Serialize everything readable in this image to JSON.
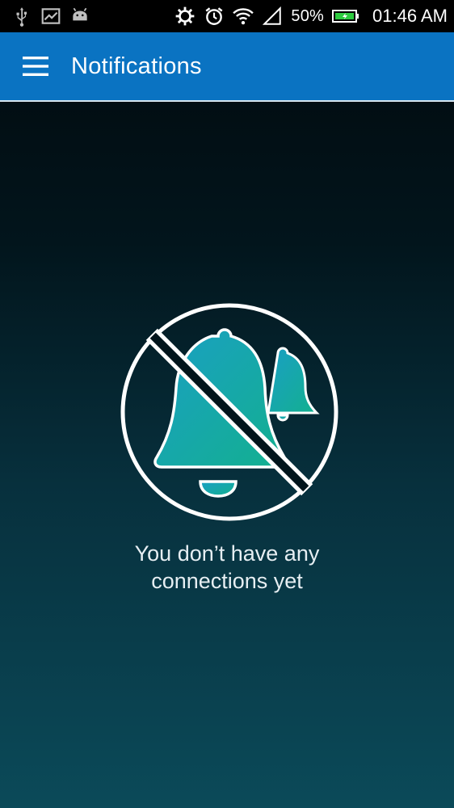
{
  "status_bar": {
    "battery_percent": "50%",
    "time": "01:46 AM",
    "icons": [
      "usb-icon",
      "image-icon",
      "android-icon",
      "sync-icon",
      "alarm-icon",
      "wifi-icon",
      "signal-icon",
      "battery-icon"
    ]
  },
  "app_bar": {
    "title": "Notifications",
    "menu_icon": "hamburger-menu-icon",
    "color": "#0a73c2"
  },
  "empty_state": {
    "icon": "notifications-off-icon",
    "line1": "You don’t have any",
    "line2": "connections yet"
  }
}
